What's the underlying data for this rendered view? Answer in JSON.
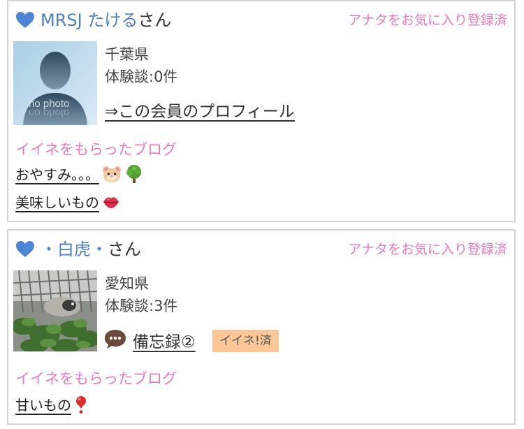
{
  "members": [
    {
      "name": "MRSJ たけるさん",
      "name_main": "MRSJ たける",
      "name_suffix": "さん",
      "fav_status": "アナタをお気に入り登録済",
      "photo_label": "no photo",
      "prefecture": "千葉県",
      "stories": "体験談:0件",
      "profile_link": "⇒この会員のプロフィール",
      "section_title": "イイネをもらったブログ",
      "blogs": [
        {
          "title": "おやすみ。。。",
          "emojis": [
            "hamster-face-icon",
            "deciduous-tree-icon"
          ]
        },
        {
          "title": "美味しいもの",
          "emojis": [
            "lips-icon"
          ]
        }
      ]
    },
    {
      "name": "・白虎・さん",
      "name_main": "・白虎・",
      "name_suffix": "さん",
      "fav_status": "アナタをお気に入り登録済",
      "prefecture": "愛知県",
      "stories": "体験談:3件",
      "latest_diary": "備忘録②",
      "like_badge": "イイネ!済",
      "section_title": "イイネをもらったブログ",
      "blogs": [
        {
          "title": "甘いもの",
          "emojis": [
            "red-exclamation-icon"
          ]
        }
      ]
    }
  ],
  "colors": {
    "accent_pink": "#e57bbe",
    "name_blue": "#4a7fc1",
    "heart_blue": "#4a86d4",
    "badge_orange": "#fcc796",
    "border": "#d4d4d4"
  }
}
